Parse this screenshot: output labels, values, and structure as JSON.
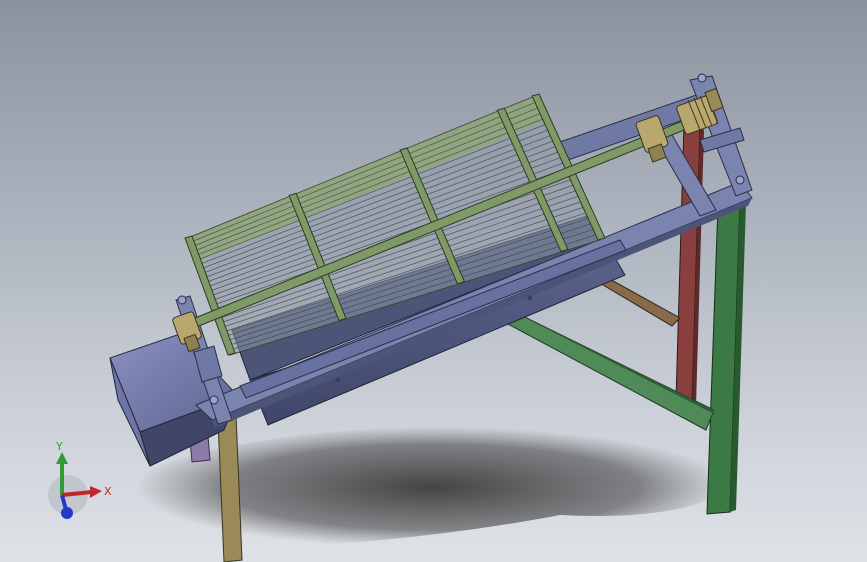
{
  "triad": {
    "x_label": "X",
    "y_label": "Y",
    "x_color": "#c0262a",
    "y_color": "#2f9d33",
    "z_color": "#2239c8"
  },
  "colors": {
    "frame_blue": "#6f7aa4",
    "frame_blue_dark": "#4c5578",
    "leg_olive": "#9a8a57",
    "leg_red": "#8a3f3f",
    "leg_green": "#3b7a44",
    "brace_brown": "#8a6a4a",
    "drum_green": "#8ea873",
    "shaft_green": "#7f9a66",
    "bearing_yellow": "#b9a86d"
  }
}
